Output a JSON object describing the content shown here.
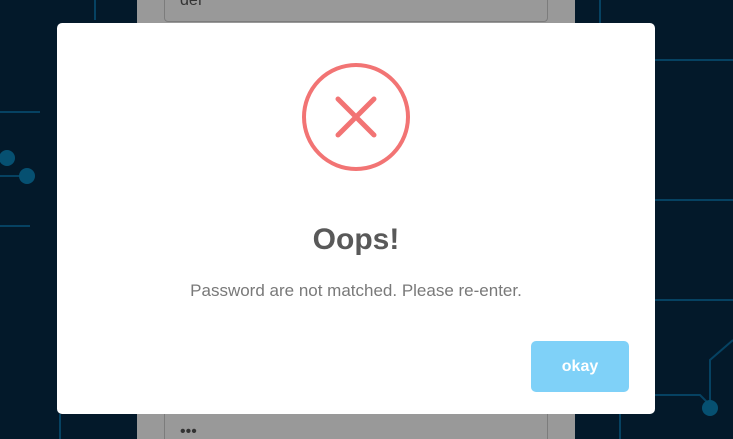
{
  "background": {
    "color": "#062a47",
    "trace_color": "#0a6fa3",
    "node_color": "#0b86bd"
  },
  "form": {
    "top_field_value": "def",
    "bottom_field_value": "•••"
  },
  "dialog": {
    "icon": "error-x-icon",
    "icon_color": "#f27474",
    "title": "Oops!",
    "message": "Password are not matched. Please re-enter.",
    "confirm_label": "okay",
    "confirm_color": "#7fd1f8"
  }
}
